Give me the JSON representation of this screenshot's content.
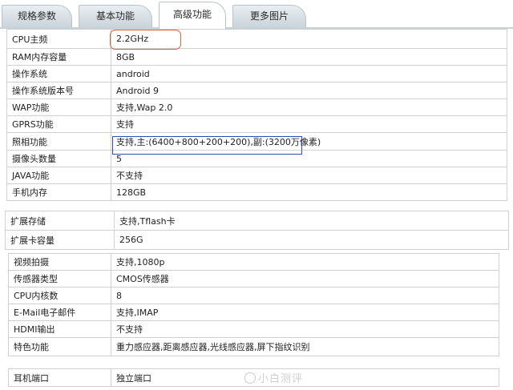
{
  "tabs": [
    {
      "label": "规格参数",
      "active": false
    },
    {
      "label": "基本功能",
      "active": false
    },
    {
      "label": "高级功能",
      "active": true
    },
    {
      "label": "更多图片",
      "active": false
    }
  ],
  "spec_block_1": [
    {
      "name": "CPU主频",
      "value": "2.2GHz"
    },
    {
      "name": "RAM内存容量",
      "value": "8GB"
    },
    {
      "name": "操作系统",
      "value": "android"
    },
    {
      "name": "操作系统版本号",
      "value": "Android 9"
    },
    {
      "name": "WAP功能",
      "value": "支持,Wap 2.0"
    },
    {
      "name": "GPRS功能",
      "value": "支持"
    },
    {
      "name": "照相功能",
      "value": "支持,主:(6400+800+200+200),副:(3200万像素)"
    },
    {
      "name": "摄像头数量",
      "value": "5"
    },
    {
      "name": "JAVA功能",
      "value": "不支持"
    },
    {
      "name": "手机内存",
      "value": "128GB"
    }
  ],
  "spec_block_2": [
    {
      "name": "扩展存储",
      "value": "支持,Tflash卡"
    },
    {
      "name": "扩展卡容量",
      "value": "256G"
    }
  ],
  "spec_block_3": [
    {
      "name": "视频拍摄",
      "value": "支持,1080p"
    },
    {
      "name": "传感器类型",
      "value": "CMOS传感器"
    },
    {
      "name": "CPU内核数",
      "value": "8"
    },
    {
      "name": "E-Mail电子邮件",
      "value": "支持,IMAP"
    },
    {
      "name": "HDMI输出",
      "value": "不支持"
    },
    {
      "name": "特色功能",
      "value": "重力感应器,距离感应器,光线感应器,屏下指纹识别"
    }
  ],
  "spec_block_4": [
    {
      "name": "耳机端口",
      "value": "独立端口"
    }
  ],
  "watermark": "小白测评",
  "colors": {
    "highlight_red": "#e0623a",
    "highlight_blue": "#2d4fa8",
    "tab_border": "#b8c4cc"
  }
}
